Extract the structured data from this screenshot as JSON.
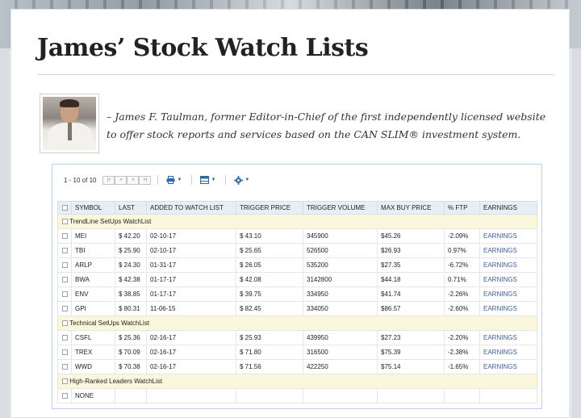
{
  "page": {
    "title": "James’ Stock Watch Lists"
  },
  "author": {
    "quote": "– James F. Taulman, former Editor-in-Chief of the first independently licensed website to offer stock reports and services based on the CAN SLIM® investment system."
  },
  "pager": {
    "count_label": "1 - 10 of 10",
    "buttons": [
      "|«",
      "«",
      "»",
      "»|"
    ]
  },
  "toolbar": {
    "icons": [
      "print-icon",
      "columns-icon",
      "settings-icon"
    ]
  },
  "table": {
    "headers": [
      "SYMBOL",
      "LAST",
      "ADDED TO WATCH LIST",
      "TRIGGER PRICE",
      "TRIGGER VOLUME",
      "MAX BUY PRICE",
      "% FTP",
      "EARNINGS"
    ],
    "groups": [
      {
        "name": "TrendLine SetUps WatchList",
        "rows": [
          [
            "MEI",
            "$ 42.20",
            "02-10-17",
            "$ 43.10",
            "345900",
            "$45.26",
            "-2.09%",
            "EARNINGS"
          ],
          [
            "TBI",
            "$ 25.90",
            "02-10-17",
            "$ 25.65",
            "526500",
            "$26.93",
            "0.97%",
            "EARNINGS"
          ],
          [
            "ARLP",
            "$ 24.30",
            "01-31-17",
            "$ 26.05",
            "535200",
            "$27.35",
            "-6.72%",
            "EARNINGS"
          ],
          [
            "BWA",
            "$ 42.38",
            "01-17-17",
            "$ 42.08",
            "3142800",
            "$44.18",
            "0.71%",
            "EARNINGS"
          ],
          [
            "ENV",
            "$ 38.85",
            "01-17-17",
            "$ 39.75",
            "334950",
            "$41.74",
            "-2.26%",
            "EARNINGS"
          ],
          [
            "GPI",
            "$ 80.31",
            "11-06-15",
            "$ 82.45",
            "334050",
            "$86.57",
            "-2.60%",
            "EARNINGS"
          ]
        ]
      },
      {
        "name": "Technical SetUps WatchList",
        "rows": [
          [
            "CSFL",
            "$ 25.36",
            "02-16-17",
            "$ 25.93",
            "439950",
            "$27.23",
            "-2.20%",
            "EARNINGS"
          ],
          [
            "TREX",
            "$ 70.09",
            "02-16-17",
            "$ 71.80",
            "316500",
            "$75.39",
            "-2.38%",
            "EARNINGS"
          ],
          [
            "WWD",
            "$ 70.38",
            "02-16-17",
            "$ 71.56",
            "422250",
            "$75.14",
            "-1.65%",
            "EARNINGS"
          ]
        ]
      },
      {
        "name": "High-Ranked Leaders WatchList",
        "rows": [
          [
            "NONE",
            "",
            "",
            "",
            "",
            "",
            "",
            ""
          ]
        ]
      }
    ]
  }
}
